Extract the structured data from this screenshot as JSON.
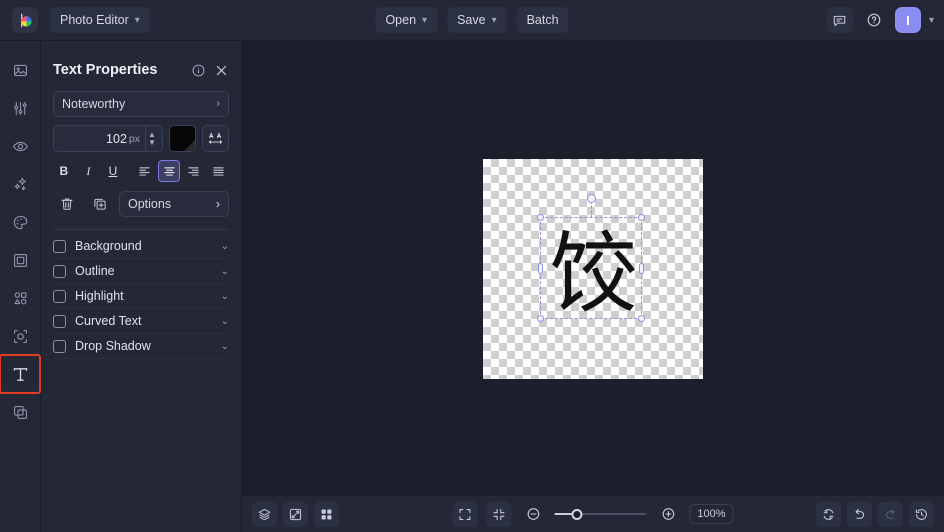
{
  "topbar": {
    "logo_name": "picsart-logo",
    "app_switcher": {
      "label": "Photo Editor",
      "chevron": "chevron-down-icon"
    },
    "center_buttons": [
      {
        "label": "Open",
        "chevron": "chevron-down-icon",
        "name": "open-button"
      },
      {
        "label": "Save",
        "chevron": "chevron-down-icon",
        "name": "save-button"
      },
      {
        "label": "Batch",
        "chevron": "",
        "name": "batch-button"
      }
    ],
    "right": {
      "feedback_icon": "comment-icon",
      "help_icon": "help-circle-icon",
      "avatar_initial": "I",
      "avatar_chevron": "chevron-down-icon"
    }
  },
  "rail": {
    "items": [
      {
        "name": "sidebar-item-image",
        "icon": "image-icon",
        "selected": false
      },
      {
        "name": "sidebar-item-adjust",
        "icon": "sliders-icon",
        "selected": false
      },
      {
        "name": "sidebar-item-retouch",
        "icon": "eye-icon",
        "selected": false
      },
      {
        "name": "sidebar-item-effects",
        "icon": "sparkles-icon",
        "selected": false
      },
      {
        "name": "sidebar-item-color",
        "icon": "palette-icon",
        "selected": false
      },
      {
        "name": "sidebar-item-frame",
        "icon": "frame-icon",
        "selected": false
      },
      {
        "name": "sidebar-item-shapes",
        "icon": "shapes-icon",
        "selected": false
      },
      {
        "name": "sidebar-item-cutout",
        "icon": "cutout-icon",
        "selected": false
      },
      {
        "name": "sidebar-item-text",
        "icon": "text-tool-icon",
        "selected": true
      },
      {
        "name": "sidebar-item-layers",
        "icon": "layers-copy-icon",
        "selected": false
      }
    ],
    "highlight_color": "#e23b26"
  },
  "panel": {
    "title": "Text Properties",
    "info_icon": "info-icon",
    "close_icon": "close-icon",
    "font": {
      "value": "Noteworthy",
      "chevron": "chevron-right-icon"
    },
    "size": {
      "value": "102",
      "unit": "px"
    },
    "color_swatch": "#000000",
    "letter_spacing_icon": "letter-spacing-icon",
    "style_buttons": [
      {
        "name": "bold-button",
        "label": "B",
        "selected": false
      },
      {
        "name": "italic-button",
        "label": "I",
        "selected": false
      },
      {
        "name": "underline-button",
        "label": "U",
        "selected": false
      }
    ],
    "align_buttons": [
      {
        "name": "align-left-button",
        "icon": "align-left-icon",
        "selected": false
      },
      {
        "name": "align-center-button",
        "icon": "align-center-icon",
        "selected": true
      },
      {
        "name": "align-right-button",
        "icon": "align-right-icon",
        "selected": false
      },
      {
        "name": "align-justify-button",
        "icon": "align-justify-icon",
        "selected": false
      }
    ],
    "delete_icon": "trash-icon",
    "duplicate_icon": "duplicate-icon",
    "options": {
      "label": "Options",
      "chevron": "chevron-right-icon"
    },
    "checks": [
      {
        "label": "Background",
        "checked": false,
        "name": "background-toggle"
      },
      {
        "label": "Outline",
        "checked": false,
        "name": "outline-toggle"
      },
      {
        "label": "Highlight",
        "checked": false,
        "name": "highlight-toggle"
      },
      {
        "label": "Curved Text",
        "checked": false,
        "name": "curved-text-toggle"
      },
      {
        "label": "Drop Shadow",
        "checked": false,
        "name": "drop-shadow-toggle"
      }
    ],
    "accent_color": "#7b7ce0"
  },
  "canvas": {
    "text_layer_value": "饺",
    "selection": "text-selection-box"
  },
  "bottombar": {
    "left_tools": [
      {
        "name": "layers-button",
        "icon": "layers-icon"
      },
      {
        "name": "compare-button",
        "icon": "compare-icon"
      },
      {
        "name": "grid-button",
        "icon": "grid-icon"
      }
    ],
    "fit_icon": "fit-screen-icon",
    "actual_size_icon": "collapse-icon",
    "zoom_out_icon": "zoom-out-icon",
    "zoom_in_icon": "zoom-in-icon",
    "zoom_level": "100%",
    "right_tools": [
      {
        "name": "reset-button",
        "icon": "reset-icon",
        "dim": false
      },
      {
        "name": "undo-button",
        "icon": "undo-icon",
        "dim": false
      },
      {
        "name": "redo-button",
        "icon": "redo-icon",
        "dim": true
      },
      {
        "name": "history-button",
        "icon": "history-icon",
        "dim": false
      }
    ]
  }
}
